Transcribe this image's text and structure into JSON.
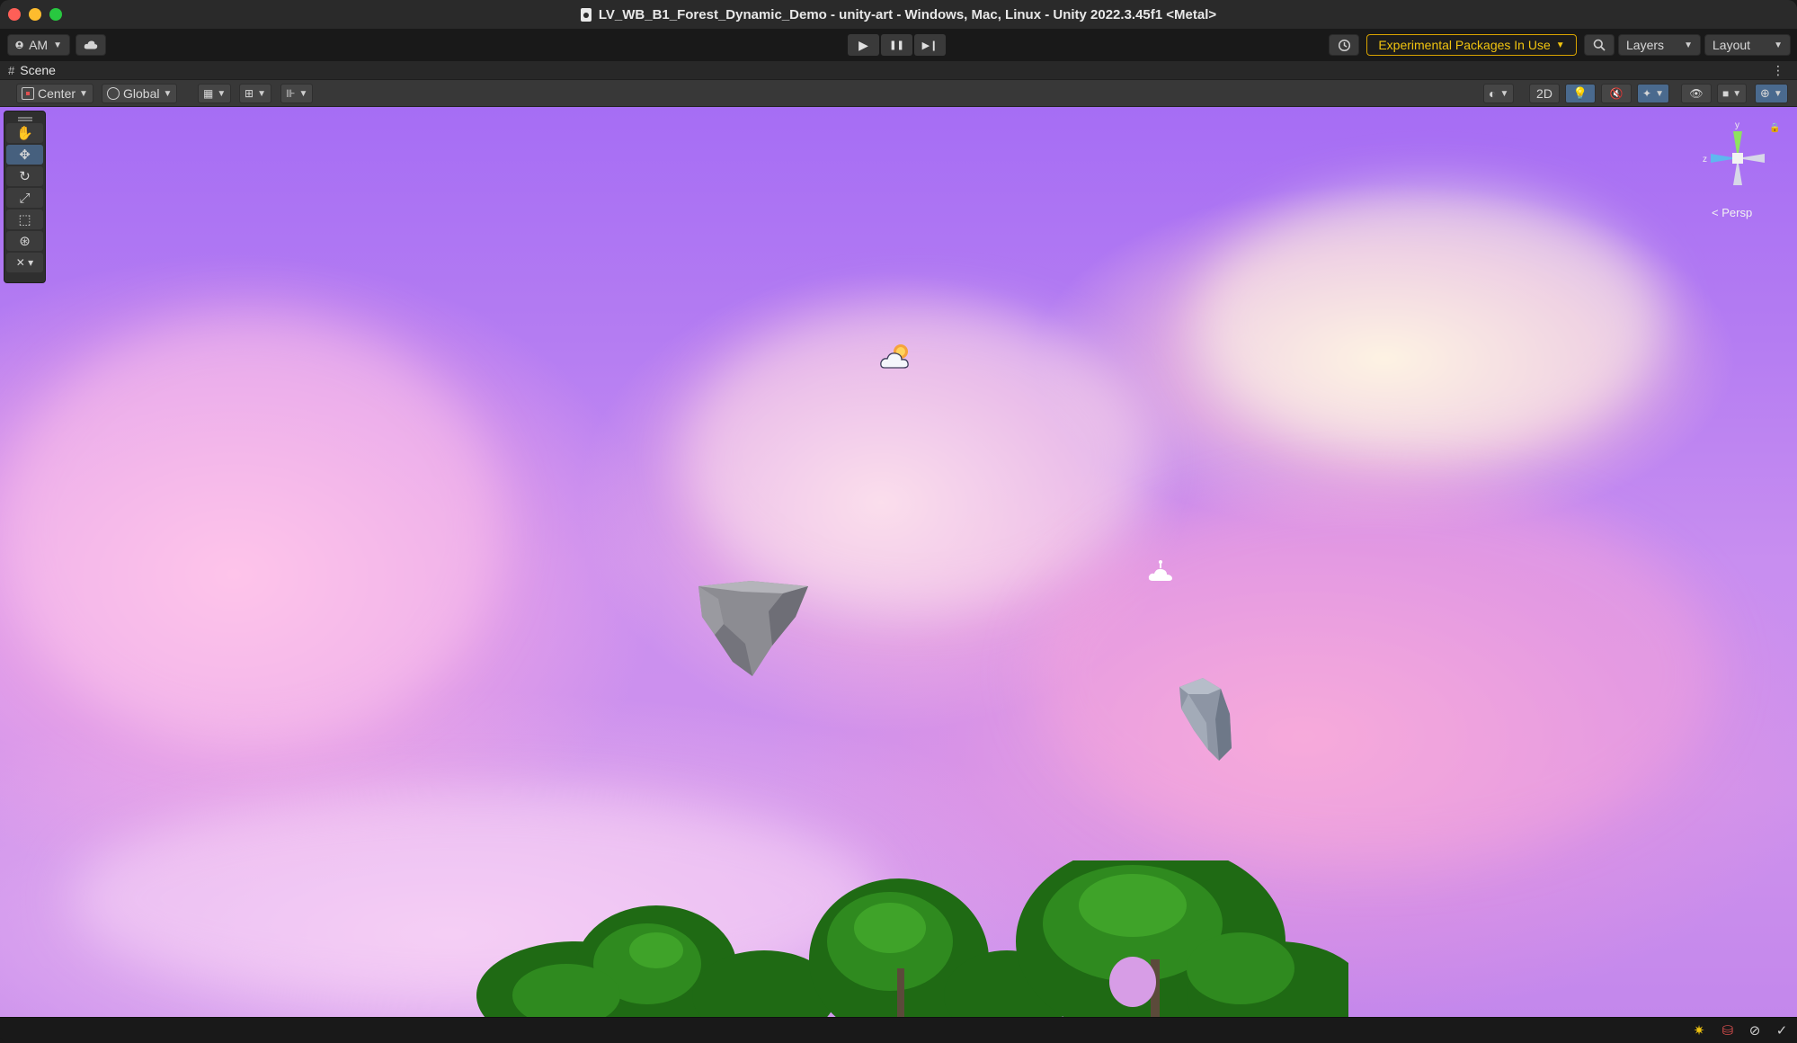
{
  "window": {
    "title": "LV_WB_B1_Forest_Dynamic_Demo - unity-art - Windows, Mac, Linux - Unity 2022.3.45f1 <Metal>"
  },
  "toolbar": {
    "account_label": "AM",
    "play_icon": "▶",
    "pause_icon": "❚❚",
    "step_icon": "▶❙",
    "experimental_label": "Experimental Packages In Use",
    "layers_label": "Layers",
    "layout_label": "Layout"
  },
  "scene_tab": {
    "label": "Scene"
  },
  "scene_toolbar": {
    "pivot_label": "Center",
    "space_label": "Global",
    "mode_2d_label": "2D"
  },
  "viewport": {
    "projection_label": "Persp",
    "gizmo_y": "y",
    "gizmo_z": "z"
  },
  "colors": {
    "accent_warning": "#f1c40f",
    "active_tool": "#46607e",
    "sky_top": "#a66df4"
  },
  "icons": [
    "account-icon",
    "cloud-icon",
    "play-icon",
    "pause-icon",
    "step-icon",
    "history-icon",
    "search-icon",
    "hand-tool-icon",
    "move-tool-icon",
    "rotate-tool-icon",
    "scale-tool-icon",
    "rect-tool-icon",
    "transform-tool-icon",
    "custom-tool-icon",
    "light-icon",
    "audio-icon",
    "effects-icon",
    "visibility-icon",
    "camera-icon",
    "gizmos-icon"
  ]
}
